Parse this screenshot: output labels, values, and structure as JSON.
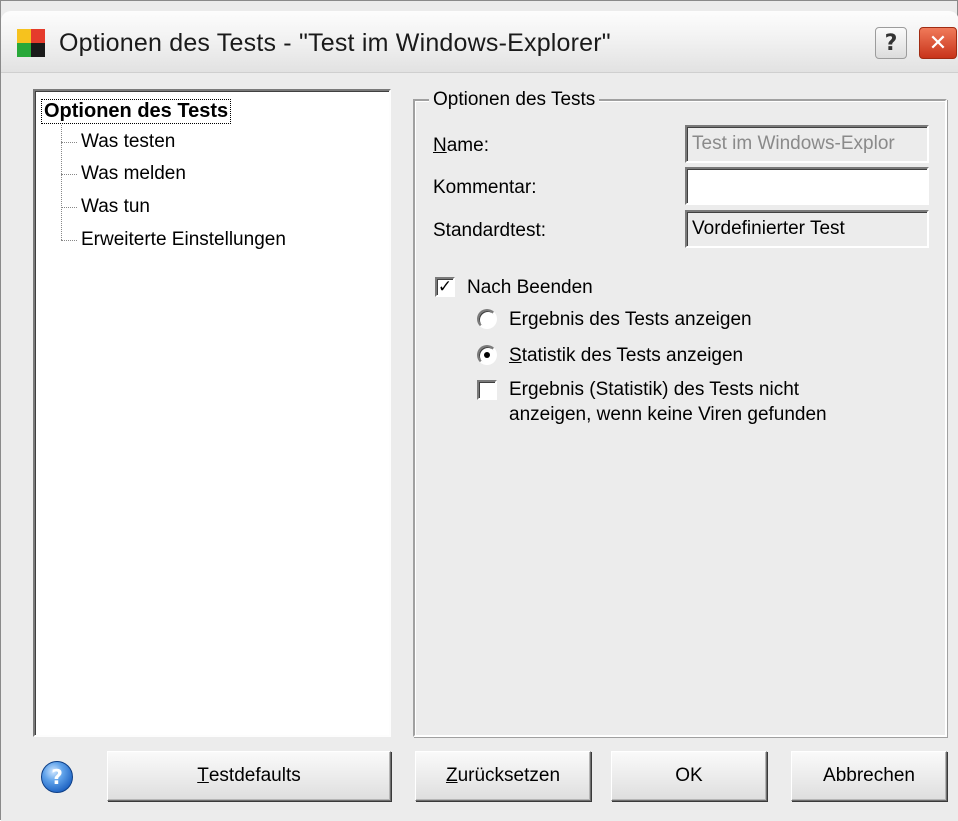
{
  "window": {
    "title": "Optionen des Tests - \"Test im Windows-Explorer\"",
    "help_glyph": "?",
    "close_glyph": "✕",
    "app_icon_colors": [
      "#e53b2c",
      "#1a1a1a",
      "#28a839",
      "#f6c21e"
    ]
  },
  "tree": {
    "root": "Optionen des Tests",
    "items": [
      "Was testen",
      "Was melden",
      "Was tun",
      "Erweiterte Einstellungen"
    ]
  },
  "group": {
    "legend": "Optionen des Tests",
    "name_label_prefix": "N",
    "name_label_rest": "ame:",
    "name_value": "Test im Windows-Explor",
    "comment_label": "Kommentar:",
    "comment_value": "",
    "standard_label": "Standardtest:",
    "standard_value": "Vordefinierter Test",
    "after_finish_label": "Nach Beenden",
    "after_finish_checked": true,
    "radio_result_label": "Ergebnis des Tests anzeigen",
    "radio_stats_label_prefix": "S",
    "radio_stats_label_rest": "tatistik des Tests anzeigen",
    "selected_radio": "statistics",
    "no_show_line1": "Ergebnis (Statistik) des Tests nicht",
    "no_show_line2": "anzeigen, wenn keine Viren gefunden",
    "no_show_checked": false
  },
  "buttons": {
    "help_glyph": "?",
    "defaults_prefix": "T",
    "defaults_rest": "estdefaults",
    "reset_prefix": "Z",
    "reset_rest": "urücksetzen",
    "ok": "OK",
    "cancel": "Abbrechen"
  }
}
